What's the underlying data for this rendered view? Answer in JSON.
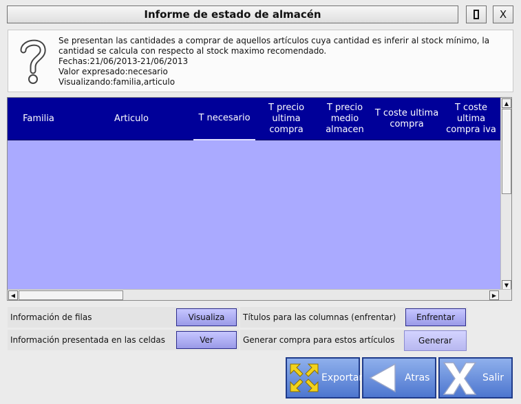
{
  "window": {
    "title": "Informe de estado de almacén",
    "close_label": "X"
  },
  "info": {
    "icon": "question-icon",
    "line1": "Se presentan las cantidades a comprar de aquellos artículos cuya cantidad es inferir al stock mínimo, la cantidad se calcula con respecto al stock maximo recomendado.",
    "line2": "Fechas:21/06/2013-21/06/2013",
    "line3": "Valor expresado:necesario",
    "line4": "Visualizando:familia,articulo"
  },
  "grid": {
    "columns": [
      {
        "label": "Familia"
      },
      {
        "label": "Articulo"
      },
      {
        "label": "T necesario"
      },
      {
        "label": "T precio ultima compra"
      },
      {
        "label": "T precio medio almacen"
      },
      {
        "label": "T coste ultima compra"
      },
      {
        "label": "T coste ultima compra iva"
      }
    ],
    "rows": []
  },
  "options": {
    "filas_label": "Información de filas",
    "filas_button": "Visualiza",
    "celdas_label": "Información presentada en las celdas",
    "celdas_button": "Ver",
    "titulos_label": "Títulos para las columnas (enfrentar)",
    "titulos_button": "Enfrentar",
    "generar_label": "Generar compra para estos artículos",
    "generar_button": "Generar"
  },
  "actions": {
    "exportar": "Exportar",
    "atras": "Atras",
    "salir": "Salir"
  },
  "colors": {
    "header_bg": "#000099",
    "grid_bg": "#aaaaff",
    "button_blue": "#4d76cf"
  }
}
